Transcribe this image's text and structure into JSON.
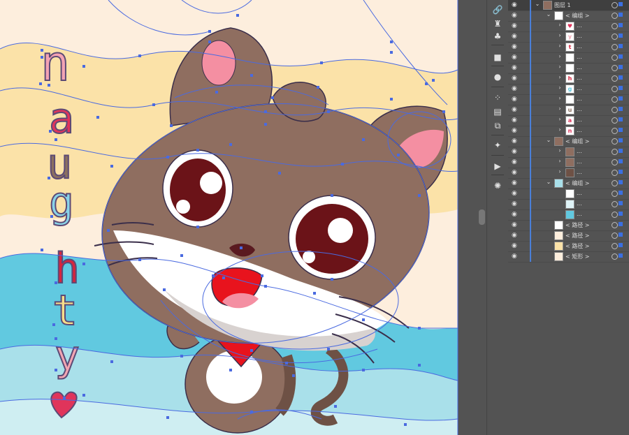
{
  "artwork": {
    "title_letters": [
      "n",
      "a",
      "u",
      "g",
      "h",
      "t",
      "y"
    ],
    "letter_colors": [
      "#f4a3b3",
      "#e0345b",
      "#8b7060",
      "#89d3e8",
      "#d7243d",
      "#f8dd8a",
      "#f2a5b2"
    ],
    "colors": {
      "bg_light": "#fdeedd",
      "bg_yellow": "#fbe2a8",
      "wave_blue": "#61c9e0",
      "wave_light": "#a9e0ea",
      "cat_brown": "#8f6e60",
      "cat_dark": "#6e5145",
      "ear_pink": "#f48fa2",
      "eye_red": "#6b1318",
      "scarf_red": "#e8131d",
      "path_blue": "#4a6ae0"
    }
  },
  "tools": {
    "link": "🔗",
    "puppet": "♜",
    "club": "♣",
    "gradient": "■",
    "sphere": "●",
    "grid": "⁘",
    "align": "▤",
    "pathfinder": "⧉",
    "wand": "✦",
    "play": "▶",
    "sun": "✺"
  },
  "layers": [
    {
      "depth": 0,
      "expanded": true,
      "label": "图层 1",
      "thumb": "cat"
    },
    {
      "depth": 1,
      "expanded": true,
      "label": "< 编组 >",
      "thumb": "white"
    },
    {
      "depth": 2,
      "expanded": false,
      "label": "...",
      "thumb": "heart"
    },
    {
      "depth": 2,
      "expanded": false,
      "label": "...",
      "thumb": "y"
    },
    {
      "depth": 2,
      "expanded": false,
      "label": "...",
      "thumb": "t"
    },
    {
      "depth": 2,
      "expanded": false,
      "label": "...",
      "thumb": "white"
    },
    {
      "depth": 2,
      "expanded": false,
      "label": "...",
      "thumb": "white"
    },
    {
      "depth": 2,
      "expanded": false,
      "label": "...",
      "thumb": "h"
    },
    {
      "depth": 2,
      "expanded": false,
      "label": "...",
      "thumb": "g"
    },
    {
      "depth": 2,
      "expanded": false,
      "label": "...",
      "thumb": "white"
    },
    {
      "depth": 2,
      "expanded": false,
      "label": "...",
      "thumb": "u"
    },
    {
      "depth": 2,
      "expanded": false,
      "label": "...",
      "thumb": "a"
    },
    {
      "depth": 2,
      "expanded": false,
      "label": "...",
      "thumb": "n"
    },
    {
      "depth": 1,
      "expanded": true,
      "label": "< 编组 >",
      "thumb": "cat"
    },
    {
      "depth": 2,
      "expanded": false,
      "label": "...",
      "thumb": "cat"
    },
    {
      "depth": 2,
      "expanded": false,
      "label": "...",
      "thumb": "cat"
    },
    {
      "depth": 2,
      "expanded": false,
      "label": "...",
      "thumb": "catb"
    },
    {
      "depth": 1,
      "expanded": true,
      "label": "< 编组 >",
      "thumb": "wave"
    },
    {
      "depth": 2,
      "expanded": null,
      "label": "...",
      "thumb": "white"
    },
    {
      "depth": 2,
      "expanded": null,
      "label": "...",
      "thumb": "wavel"
    },
    {
      "depth": 2,
      "expanded": null,
      "label": "...",
      "thumb": "waveb"
    },
    {
      "depth": 1,
      "expanded": null,
      "label": "< 路径 >",
      "thumb": "white"
    },
    {
      "depth": 1,
      "expanded": null,
      "label": "< 路径 >",
      "thumb": "peach"
    },
    {
      "depth": 1,
      "expanded": null,
      "label": "< 路径 >",
      "thumb": "yellow"
    },
    {
      "depth": 1,
      "expanded": null,
      "label": "< 矩形 >",
      "thumb": "peach"
    }
  ]
}
